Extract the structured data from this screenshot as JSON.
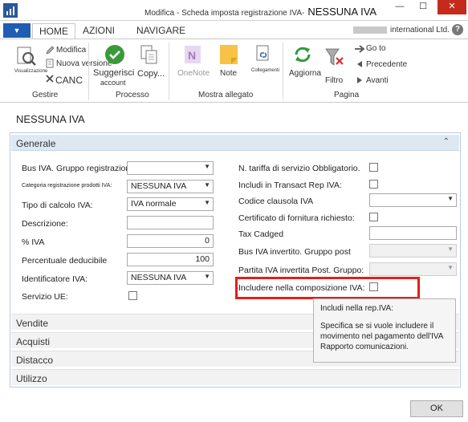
{
  "window": {
    "title_prefix": "Modifica - Scheda imposta registrazione IVA-",
    "title_record": "NESSUNA IVA",
    "minimize": "—",
    "maximize": "☐",
    "close": "✕"
  },
  "tabs": {
    "file": "▼",
    "items": [
      "HOME",
      "AZIONI",
      "NAVIGARE"
    ]
  },
  "company": "international Ltd.",
  "help": "?",
  "ribbon": {
    "manage": {
      "visualizza": "Visualizzazione",
      "modifica": "Modifica",
      "nuova_versione": "Nuova versione",
      "cancel": "CANC",
      "group": "Gestire"
    },
    "process": {
      "suggerisci": "Suggerisci",
      "account": "account",
      "copy": "Copy...",
      "group": "Processo"
    },
    "attachments": {
      "onenote": "OneNote",
      "note": "Note",
      "collegamenti": "Collegamenti",
      "group": "Mostra allegato"
    },
    "page": {
      "aggiorna": "Aggiorna",
      "filtro": "Filtro",
      "goto": "Go to",
      "precedente": "Precedente",
      "avanti": "Avanti",
      "group": "Pagina"
    }
  },
  "page_title": "NESSUNA IVA",
  "general": {
    "header": "Generale",
    "chevron": "⌃",
    "left": {
      "bus_label": "Bus IVA. Gruppo registrazione:",
      "bus_value": "",
      "cat_label": "Categoria registrazione prodotti IVA:",
      "cat_value": "NESSUNA IVA",
      "tipo_label": "Tipo di calcolo IVA:",
      "tipo_value": "IVA normale",
      "desc_label": "Descrizione:",
      "desc_value": "",
      "pct_label": "% IVA",
      "pct_value": "0",
      "ded_label": "Percentuale deducibile",
      "ded_value": "100",
      "id_label": "Identificatore IVA:",
      "id_value": "NESSUNA IVA",
      "ue_label": "Servizio UE:"
    },
    "right": {
      "tariff_label": "N. tariffa di servizio Obbligatorio.",
      "transact_label": "Includi in Transact Rep IVA:",
      "clause_label": "Codice clausola IVA",
      "clause_value": "",
      "cert_label": "Certificato di fornitura richiesto:",
      "tax_label": "Tax Cadged",
      "tax_value": "",
      "bus_rev_label": "Bus IVA invertito. Gruppo post",
      "bus_rev_value": "",
      "partita_label": "Partita IVA invertita Post. Gruppo:",
      "partita_value": "",
      "includere_label": "Includere nella composizione IVA:"
    }
  },
  "tooltip": {
    "title": "Includi nella rep.IVA:",
    "body": "Specifica se si vuole includere il movimento nel pagamento dell'IVA Rapporto comunicazioni."
  },
  "fasttabs": [
    "Vendite",
    "Acquisti",
    "Distacco",
    "Utilizzo"
  ],
  "ok": "OK",
  "colors": {
    "accent": "#1e5db2",
    "section_header": "#dde8f3",
    "highlight": "#e0201b",
    "tooltip_bg": "#f5f5f5"
  }
}
